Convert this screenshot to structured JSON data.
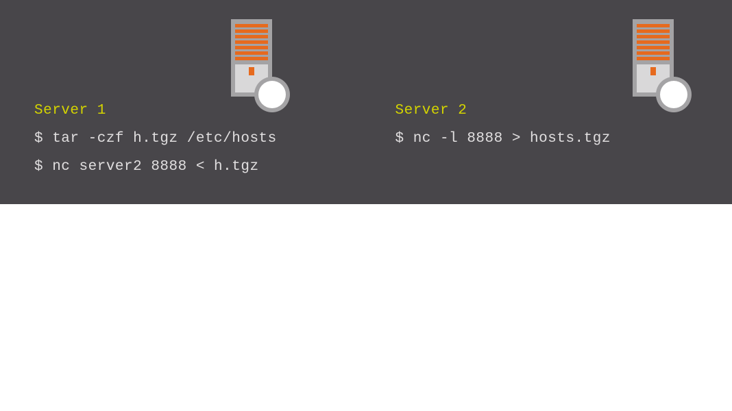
{
  "server1": {
    "title": "Server 1",
    "commands": [
      "$ tar -czf h.tgz /etc/hosts",
      "$ nc server2 8888 < h.tgz"
    ]
  },
  "server2": {
    "title": "Server 2",
    "commands": [
      "$ nc -l 8888 > hosts.tgz"
    ]
  },
  "colors": {
    "panel_bg": "#48464a",
    "title": "#d4d400",
    "text": "#e0dedf",
    "server_orange": "#e66a1e",
    "server_gray": "#a4a3a5"
  }
}
